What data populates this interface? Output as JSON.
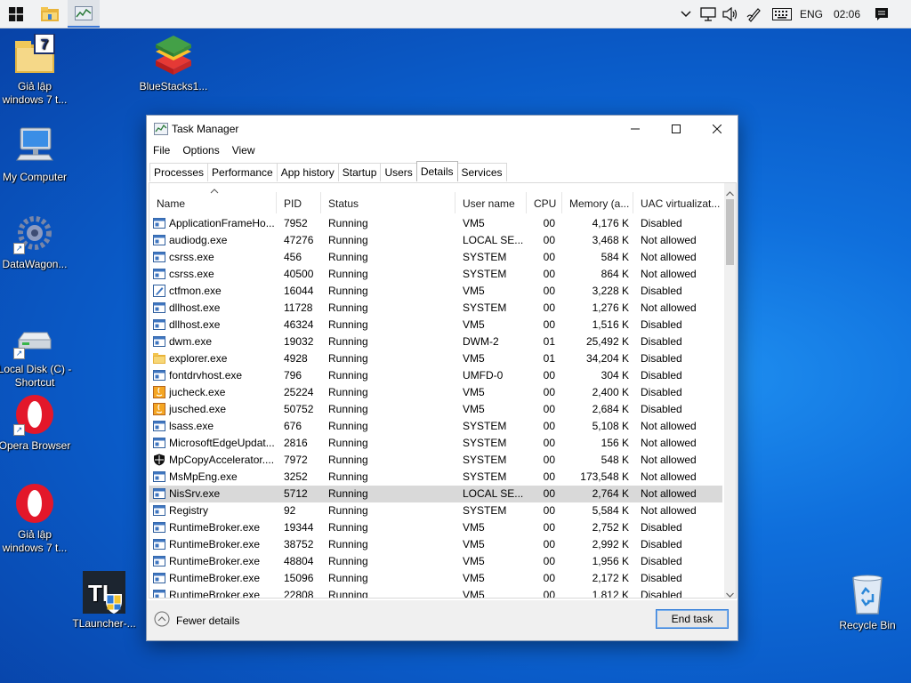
{
  "taskbar": {
    "tray": {
      "language": "ENG",
      "time": "02:06"
    },
    "icons": [
      "windows-start-icon",
      "file-explorer-icon",
      "task-manager-icon",
      "chevron-up-icon",
      "network-icon",
      "volume-icon",
      "pen-icon",
      "keyboard-icon",
      "action-center-icon"
    ]
  },
  "desktop": {
    "icons": [
      {
        "label": "Giả lập windows 7 t..."
      },
      {
        "label": "BlueStacks1..."
      },
      {
        "label": "My Computer"
      },
      {
        "label": "DataWagon..."
      },
      {
        "label": "Local Disk (C) - Shortcut"
      },
      {
        "label": "Opera Browser"
      },
      {
        "label": "Giả lập windows 7 t..."
      },
      {
        "label": "TLauncher-..."
      },
      {
        "label": "Recycle Bin"
      }
    ]
  },
  "window": {
    "title": "Task Manager",
    "menu": [
      "File",
      "Options",
      "View"
    ],
    "tabs": [
      "Processes",
      "Performance",
      "App history",
      "Startup",
      "Users",
      "Details",
      "Services"
    ],
    "active_tab": "Details",
    "columns": [
      "Name",
      "PID",
      "Status",
      "User name",
      "CPU",
      "Memory (a...",
      "UAC virtualizat..."
    ],
    "rows": [
      {
        "name": "ApplicationFrameHo...",
        "pid": "7952",
        "status": "Running",
        "user": "VM5",
        "cpu": "00",
        "mem": "4,176 K",
        "uac": "Disabled",
        "icon": "window-icon"
      },
      {
        "name": "audiodg.exe",
        "pid": "47276",
        "status": "Running",
        "user": "LOCAL SE...",
        "cpu": "00",
        "mem": "3,468 K",
        "uac": "Not allowed",
        "icon": "window-icon"
      },
      {
        "name": "csrss.exe",
        "pid": "456",
        "status": "Running",
        "user": "SYSTEM",
        "cpu": "00",
        "mem": "584 K",
        "uac": "Not allowed",
        "icon": "window-icon"
      },
      {
        "name": "csrss.exe",
        "pid": "40500",
        "status": "Running",
        "user": "SYSTEM",
        "cpu": "00",
        "mem": "864 K",
        "uac": "Not allowed",
        "icon": "window-icon"
      },
      {
        "name": "ctfmon.exe",
        "pid": "16044",
        "status": "Running",
        "user": "VM5",
        "cpu": "00",
        "mem": "3,228 K",
        "uac": "Disabled",
        "icon": "pen-icon"
      },
      {
        "name": "dllhost.exe",
        "pid": "11728",
        "status": "Running",
        "user": "SYSTEM",
        "cpu": "00",
        "mem": "1,276 K",
        "uac": "Not allowed",
        "icon": "window-icon"
      },
      {
        "name": "dllhost.exe",
        "pid": "46324",
        "status": "Running",
        "user": "VM5",
        "cpu": "00",
        "mem": "1,516 K",
        "uac": "Disabled",
        "icon": "window-icon"
      },
      {
        "name": "dwm.exe",
        "pid": "19032",
        "status": "Running",
        "user": "DWM-2",
        "cpu": "01",
        "mem": "25,492 K",
        "uac": "Disabled",
        "icon": "window-icon"
      },
      {
        "name": "explorer.exe",
        "pid": "4928",
        "status": "Running",
        "user": "VM5",
        "cpu": "01",
        "mem": "34,204 K",
        "uac": "Disabled",
        "icon": "folder-icon"
      },
      {
        "name": "fontdrvhost.exe",
        "pid": "796",
        "status": "Running",
        "user": "UMFD-0",
        "cpu": "00",
        "mem": "304 K",
        "uac": "Disabled",
        "icon": "window-icon"
      },
      {
        "name": "jucheck.exe",
        "pid": "25224",
        "status": "Running",
        "user": "VM5",
        "cpu": "00",
        "mem": "2,400 K",
        "uac": "Disabled",
        "icon": "java-icon"
      },
      {
        "name": "jusched.exe",
        "pid": "50752",
        "status": "Running",
        "user": "VM5",
        "cpu": "00",
        "mem": "2,684 K",
        "uac": "Disabled",
        "icon": "java-icon"
      },
      {
        "name": "lsass.exe",
        "pid": "676",
        "status": "Running",
        "user": "SYSTEM",
        "cpu": "00",
        "mem": "5,108 K",
        "uac": "Not allowed",
        "icon": "window-icon"
      },
      {
        "name": "MicrosoftEdgeUpdat...",
        "pid": "2816",
        "status": "Running",
        "user": "SYSTEM",
        "cpu": "00",
        "mem": "156 K",
        "uac": "Not allowed",
        "icon": "window-icon"
      },
      {
        "name": "MpCopyAccelerator....",
        "pid": "7972",
        "status": "Running",
        "user": "SYSTEM",
        "cpu": "00",
        "mem": "548 K",
        "uac": "Not allowed",
        "icon": "shield-icon"
      },
      {
        "name": "MsMpEng.exe",
        "pid": "3252",
        "status": "Running",
        "user": "SYSTEM",
        "cpu": "00",
        "mem": "173,548 K",
        "uac": "Not allowed",
        "icon": "window-icon"
      },
      {
        "name": "NisSrv.exe",
        "pid": "5712",
        "status": "Running",
        "user": "LOCAL SE...",
        "cpu": "00",
        "mem": "2,764 K",
        "uac": "Not allowed",
        "icon": "window-icon",
        "selected": true
      },
      {
        "name": "Registry",
        "pid": "92",
        "status": "Running",
        "user": "SYSTEM",
        "cpu": "00",
        "mem": "5,584 K",
        "uac": "Not allowed",
        "icon": "window-icon"
      },
      {
        "name": "RuntimeBroker.exe",
        "pid": "19344",
        "status": "Running",
        "user": "VM5",
        "cpu": "00",
        "mem": "2,752 K",
        "uac": "Disabled",
        "icon": "window-icon"
      },
      {
        "name": "RuntimeBroker.exe",
        "pid": "38752",
        "status": "Running",
        "user": "VM5",
        "cpu": "00",
        "mem": "2,992 K",
        "uac": "Disabled",
        "icon": "window-icon"
      },
      {
        "name": "RuntimeBroker.exe",
        "pid": "48804",
        "status": "Running",
        "user": "VM5",
        "cpu": "00",
        "mem": "1,956 K",
        "uac": "Disabled",
        "icon": "window-icon"
      },
      {
        "name": "RuntimeBroker.exe",
        "pid": "15096",
        "status": "Running",
        "user": "VM5",
        "cpu": "00",
        "mem": "2,172 K",
        "uac": "Disabled",
        "icon": "window-icon"
      },
      {
        "name": "RuntimeBroker.exe",
        "pid": "22808",
        "status": "Running",
        "user": "VM5",
        "cpu": "00",
        "mem": "1,812 K",
        "uac": "Disabled",
        "icon": "window-icon"
      }
    ],
    "footer": {
      "fewer_details": "Fewer details",
      "end_task": "End task"
    }
  },
  "colors": {
    "desktop_blue": "#0a5bc8",
    "selection": "#d9d9d9",
    "accent": "#2f7bd8"
  }
}
